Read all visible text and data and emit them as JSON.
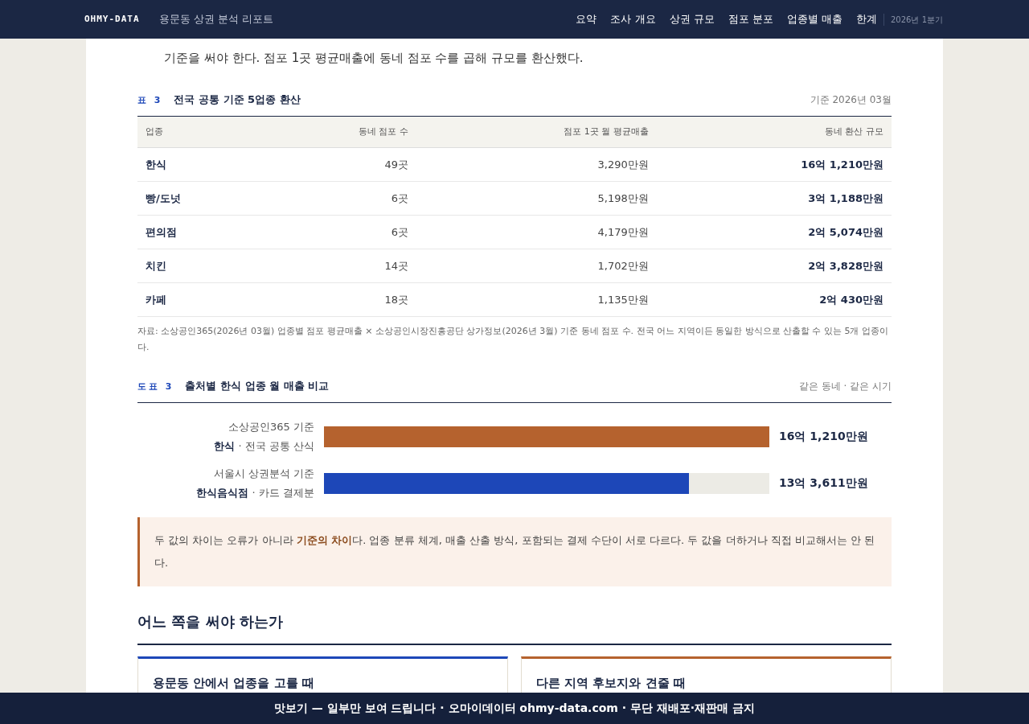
{
  "header": {
    "logo": "OHMY-DATA",
    "title": "용문동 상권 분석 리포트",
    "nav": [
      {
        "label": "요약",
        "selected": false
      },
      {
        "label": "조사 개요",
        "selected": false
      },
      {
        "label": "상권 규모",
        "selected": false
      },
      {
        "label": "점포 분포",
        "selected": false
      },
      {
        "label": "업종별 매출",
        "selected": false
      },
      {
        "label": "한계",
        "selected": false
      }
    ],
    "period": "2026년 1분기"
  },
  "intro": "기준을 써야 한다. 점포 1곳 평균매출에 동네 점포 수를 곱해 규모를 환산했다.",
  "table": {
    "label": "표 3",
    "title": "전국 공통 기준 5업종 환산",
    "meta": "기준 2026년 03월",
    "columns": [
      "업종",
      "동네 점포 수",
      "점포 1곳 월 평균매출",
      "동네 환산 규모"
    ],
    "rows": [
      [
        "한식",
        "49곳",
        "3,290만원",
        "16억 1,210만원"
      ],
      [
        "빵/도넛",
        "6곳",
        "5,198만원",
        "3억 1,188만원"
      ],
      [
        "편의점",
        "6곳",
        "4,179만원",
        "2억 5,074만원"
      ],
      [
        "치킨",
        "14곳",
        "1,702만원",
        "2억 3,828만원"
      ],
      [
        "카페",
        "18곳",
        "1,135만원",
        "2억 430만원"
      ]
    ],
    "source": "자료: 소상공인365(2026년 03월) 업종별 점포 평균매출 × 소상공인시장진흥공단 상가정보(2026년 3월) 기준 동네 점포 수. 전국 어느 지역이든 동일한 방식으로 산출할 수 있는 5개 업종이다."
  },
  "figure": {
    "label": "도표 3",
    "title": "출처별 한식 업종 월 매출 비교",
    "meta": "같은 동네 · 같은 시기",
    "bars": [
      {
        "source": "소상공인365 기준",
        "category": "**한식** · 전국 공통 산식",
        "level": 1,
        "color": "#b5622e",
        "value": "16억 1,210만원"
      },
      {
        "source": "서울시 상권분석 기준",
        "category": "**한식음식점** · 카드 결제분",
        "level": 0.82,
        "color": "#1d47b8",
        "value": "13억 3,611만원"
      }
    ]
  },
  "callout": "두 값의 차이는 오류가 아니라 **기준의 차이**다. 업종 분류 체계, 매출 산출 방식, 포함되는 결제 수단이 서로 다르다. 두 값을 더하거나 직접 비교해서는 안 된다.",
  "section": {
    "title": "어느 쪽을 써야 하는가",
    "cards": [
      {
        "title": "용문동 안에서 업종을 고를 때",
        "color": "#1d47b8"
      },
      {
        "title": "다른 지역 후보지와 견줄 때",
        "color": "#b5622e"
      }
    ]
  },
  "footer": "맛보기 — 일부만 보여 드립니다 · 오마이데이터 ohmy-data.com · 무단 재배포·재판매 금지"
}
